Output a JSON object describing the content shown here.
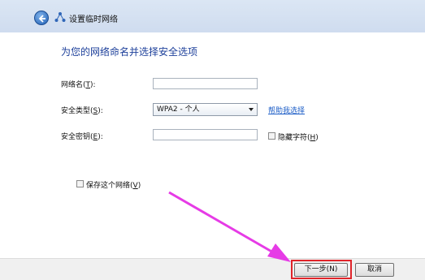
{
  "window": {
    "title": "设置临时网络",
    "heading": "为您的网络命名并选择安全选项"
  },
  "form": {
    "network_name": {
      "label_prefix": "网络名(",
      "accel": "T",
      "label_suffix": "):",
      "value": ""
    },
    "security_type": {
      "label_prefix": "安全类型(",
      "accel": "S",
      "label_suffix": "):",
      "selected": "WPA2 - 个人"
    },
    "help_link": "帮助我选择",
    "security_key": {
      "label_prefix": "安全密钥(",
      "accel": "E",
      "label_suffix": "):",
      "value": ""
    },
    "hide_chars": {
      "label_prefix": "隐藏字符(",
      "accel": "H",
      "label_suffix": ")",
      "checked": false
    },
    "save_network": {
      "label_prefix": "保存这个网络(",
      "accel": "V",
      "label_suffix": ")",
      "checked": false
    }
  },
  "buttons": {
    "next": {
      "label": "下一步(N)"
    },
    "cancel": {
      "label": "取消"
    }
  },
  "colors": {
    "heading": "#1c3f9a",
    "link": "#1d5ec7",
    "highlight": "#e0242a",
    "arrow": "#e63be6"
  },
  "icons": [
    "back-arrow-icon",
    "network-icon",
    "dropdown-arrow-icon"
  ]
}
